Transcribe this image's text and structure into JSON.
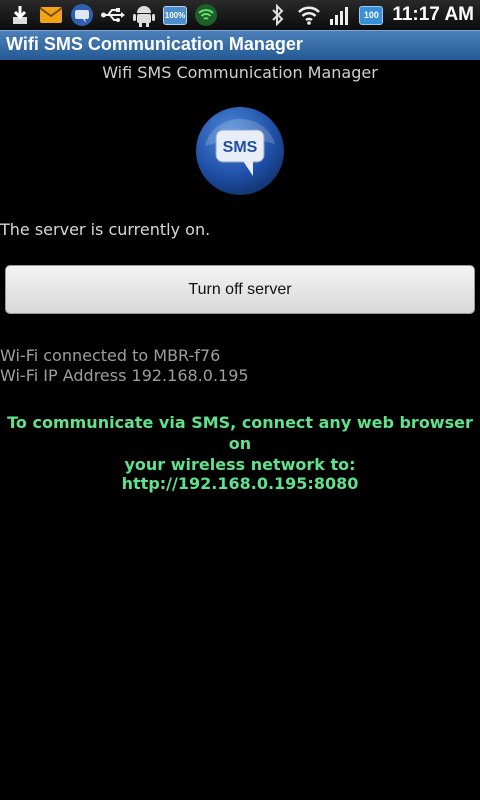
{
  "status_bar": {
    "time": "11:17 AM",
    "battery_notification_text": "100%",
    "battery_level_text": "100",
    "left_icons": [
      "download-icon",
      "mail-icon",
      "sms-icon",
      "usb-icon",
      "android-debug-icon",
      "battery-full-icon",
      "wifi-shield-icon"
    ],
    "right_icons": [
      "bluetooth-icon",
      "wifi-icon",
      "signal-icon",
      "battery-icon"
    ]
  },
  "app": {
    "title": "Wifi SMS Communication Manager",
    "subtitle": "Wifi SMS Communication Manager",
    "logo_text": "SMS"
  },
  "server": {
    "status_text": "The server is currently on.",
    "button_label": "Turn off server"
  },
  "wifi": {
    "connected_text": "Wi-Fi connected to MBR-f76",
    "ip_text": "Wi-Fi IP Address 192.168.0.195"
  },
  "instructions": {
    "line1": "To communicate via SMS, connect any web browser on",
    "line2": "your wireless network to:",
    "url": "http://192.168.0.195:8080"
  },
  "colors": {
    "title_bar": "#2f66a3",
    "accent_green": "#5fe28b",
    "background": "#000000"
  }
}
